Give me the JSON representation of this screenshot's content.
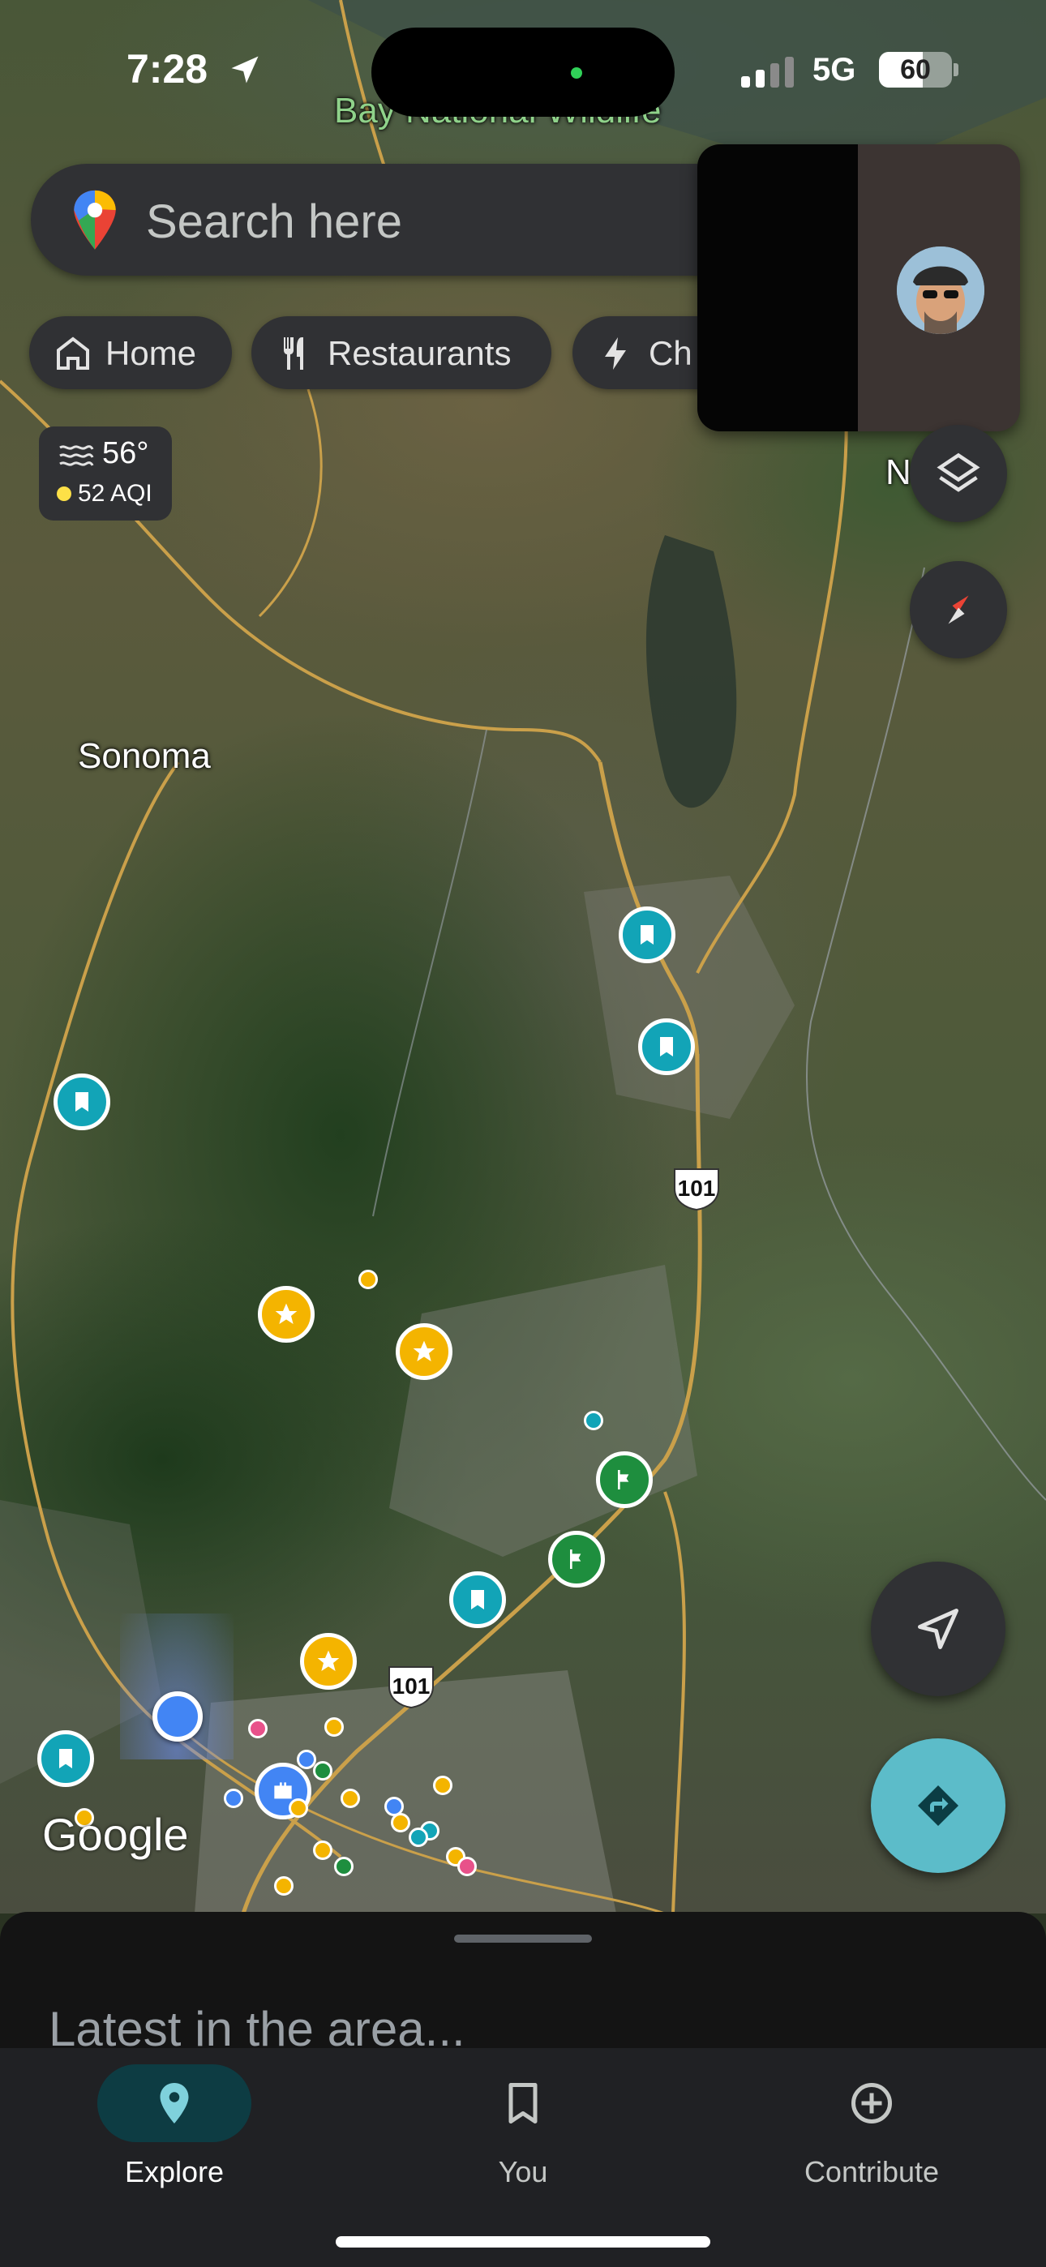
{
  "status_bar": {
    "time": "7:28",
    "network": "5G",
    "battery": "60",
    "battery_level": 0.6
  },
  "search": {
    "placeholder": "Search here"
  },
  "chips": [
    {
      "label": "Home",
      "icon": "home-icon"
    },
    {
      "label": "Restaurants",
      "icon": "fork-knife-icon"
    },
    {
      "label": "Ch",
      "icon": "bolt-icon"
    }
  ],
  "weather": {
    "temperature": "56°",
    "aqi": "52 AQI"
  },
  "map": {
    "place_labels": {
      "bay_refuge": "Bay National Wildlife",
      "sonoma": "Sonoma",
      "napa_partial": "N"
    },
    "highway_shields": [
      "101",
      "101"
    ],
    "attribution": "Google"
  },
  "bottom_sheet": {
    "title": "Latest in the area..."
  },
  "nav": {
    "items": [
      {
        "label": "Explore",
        "icon": "location-pin-icon",
        "active": true
      },
      {
        "label": "You",
        "icon": "bookmark-icon",
        "active": false
      },
      {
        "label": "Contribute",
        "icon": "add-circle-icon",
        "active": false
      }
    ]
  },
  "colors": {
    "accent_teal": "#12a4b7",
    "directions_fab": "#5cbcc9",
    "saved_marker": "#12a4b7",
    "starred_marker": "#f4b400",
    "flag_marker": "#1e8e3e"
  }
}
